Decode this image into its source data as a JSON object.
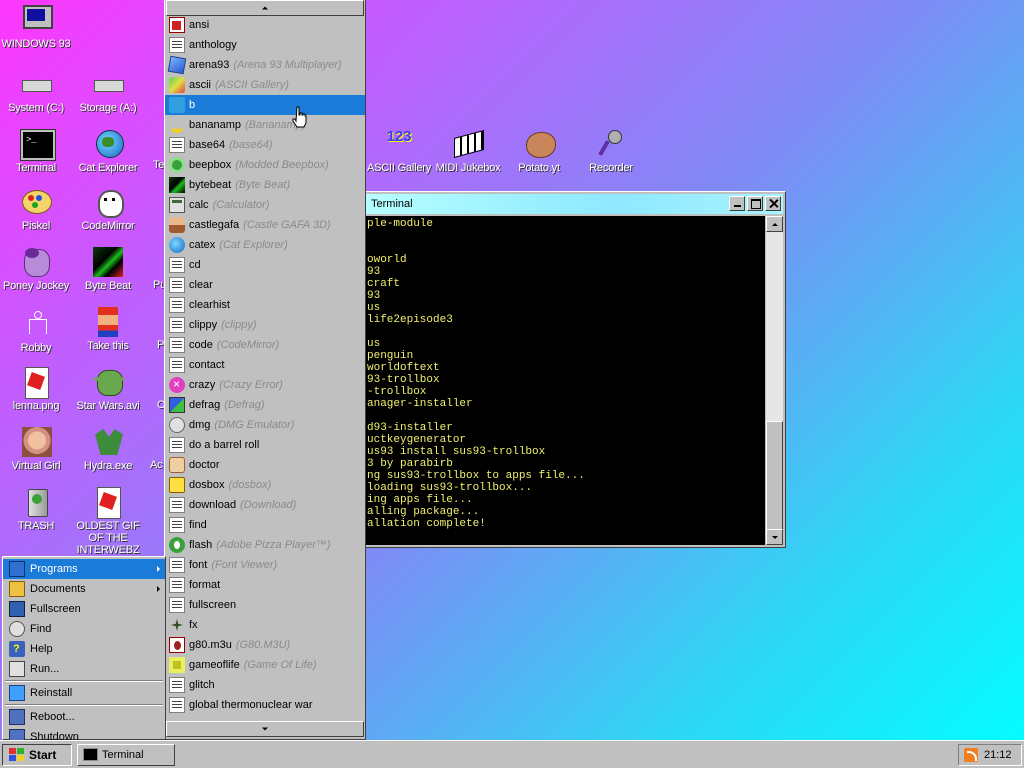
{
  "desktop": {
    "icons": [
      {
        "label": "WINDOWS 93",
        "icon": "monitor-icon"
      },
      {
        "label": "System (C:)",
        "icon": "drive-icon"
      },
      {
        "label": "Storage (A:)",
        "icon": "floppy-drive-icon"
      },
      {
        "label": "Terminal",
        "icon": "terminal-icon"
      },
      {
        "label": "Cat Explorer",
        "icon": "cat-globe-icon"
      },
      {
        "label": "Piskel",
        "icon": "palette-icon"
      },
      {
        "label": "CodeMirror",
        "icon": "cat-icon"
      },
      {
        "label": "Poney Jockey",
        "icon": "pony-icon"
      },
      {
        "label": "Byte Beat",
        "icon": "bytebeat-icon"
      },
      {
        "label": "Robby",
        "icon": "robot-icon"
      },
      {
        "label": "Take this",
        "icon": "mario-icon"
      },
      {
        "label": "lenna.png",
        "icon": "image-icon"
      },
      {
        "label": "Star Wars.avi",
        "icon": "yoda-icon"
      },
      {
        "label": "Virtual Girl",
        "icon": "face-icon"
      },
      {
        "label": "Hydra.exe",
        "icon": "hydra-icon"
      },
      {
        "label": "TRASH",
        "icon": "trash-icon"
      },
      {
        "label": "OLDEST GIF OF THE INTERWEBZ",
        "icon": "gif-icon"
      },
      {
        "label": "ASCII Gallery",
        "icon": "numbers-icon"
      },
      {
        "label": "MIDI Jukebox",
        "icon": "piano-icon"
      },
      {
        "label": "Potato.yt",
        "icon": "potato-icon"
      },
      {
        "label": "Recorder",
        "icon": "microphone-icon"
      }
    ],
    "partial_labels": [
      "Te",
      "Pu",
      "P",
      "O",
      "Ac"
    ]
  },
  "programs_menu": {
    "selected_index": 4,
    "items": [
      {
        "name": "ansi",
        "desc": "",
        "icon": "ansi"
      },
      {
        "name": "anthology",
        "desc": "",
        "icon": "generic"
      },
      {
        "name": "arena93",
        "desc": "(Arena 93 Multiplayer)",
        "icon": "cube"
      },
      {
        "name": "ascii",
        "desc": "(ASCII Gallery)",
        "icon": "art"
      },
      {
        "name": "b",
        "desc": "",
        "icon": "b"
      },
      {
        "name": "bananamp",
        "desc": "(Bananamp)",
        "icon": "banana"
      },
      {
        "name": "base64",
        "desc": "(base64)",
        "icon": "generic"
      },
      {
        "name": "beepbox",
        "desc": "(Modded Beepbox)",
        "icon": "circle"
      },
      {
        "name": "bytebeat",
        "desc": "(Byte Beat)",
        "icon": "bytebeat"
      },
      {
        "name": "calc",
        "desc": "(Calculator)",
        "icon": "calc"
      },
      {
        "name": "castlegafa",
        "desc": "(Castle GAFA 3D)",
        "icon": "castle"
      },
      {
        "name": "catex",
        "desc": "(Cat Explorer)",
        "icon": "catglobe"
      },
      {
        "name": "cd",
        "desc": "",
        "icon": "generic"
      },
      {
        "name": "clear",
        "desc": "",
        "icon": "generic"
      },
      {
        "name": "clearhist",
        "desc": "",
        "icon": "generic"
      },
      {
        "name": "clippy",
        "desc": "(clippy)",
        "icon": "generic"
      },
      {
        "name": "code",
        "desc": "(CodeMirror)",
        "icon": "generic"
      },
      {
        "name": "contact",
        "desc": "",
        "icon": "generic"
      },
      {
        "name": "crazy",
        "desc": "(Crazy Error)",
        "icon": "crazy"
      },
      {
        "name": "defrag",
        "desc": "(Defrag)",
        "icon": "defrag"
      },
      {
        "name": "dmg",
        "desc": "(DMG Emulator)",
        "icon": "dmg"
      },
      {
        "name": "do a barrel roll",
        "desc": "",
        "icon": "generic"
      },
      {
        "name": "doctor",
        "desc": "",
        "icon": "doctor"
      },
      {
        "name": "dosbox",
        "desc": "(dosbox)",
        "icon": "dosbox"
      },
      {
        "name": "download",
        "desc": "(Download)",
        "icon": "generic"
      },
      {
        "name": "find",
        "desc": "",
        "icon": "generic"
      },
      {
        "name": "flash",
        "desc": "(Adobe Pizza Player™)",
        "icon": "flash"
      },
      {
        "name": "font",
        "desc": "(Font Viewer)",
        "icon": "generic"
      },
      {
        "name": "format",
        "desc": "",
        "icon": "generic"
      },
      {
        "name": "fullscreen",
        "desc": "",
        "icon": "generic"
      },
      {
        "name": "fx",
        "desc": "",
        "icon": "fx"
      },
      {
        "name": "g80.m3u",
        "desc": "(G80.M3U)",
        "icon": "g80"
      },
      {
        "name": "gameoflife",
        "desc": "(Game Of Life)",
        "icon": "life"
      },
      {
        "name": "glitch",
        "desc": "",
        "icon": "generic"
      },
      {
        "name": "global thermonuclear war",
        "desc": "",
        "icon": "generic"
      }
    ]
  },
  "start_menu": {
    "items": [
      {
        "label": "Programs",
        "submenu": true,
        "icon": "programs"
      },
      {
        "label": "Documents",
        "submenu": true,
        "icon": "folder"
      },
      {
        "label": "Fullscreen",
        "submenu": false,
        "icon": "full"
      },
      {
        "label": "Find",
        "submenu": false,
        "icon": "find"
      },
      {
        "label": "Help",
        "submenu": false,
        "icon": "help"
      },
      {
        "label": "Run...",
        "submenu": false,
        "icon": "run"
      },
      {
        "label": "Reinstall",
        "submenu": false,
        "icon": "reinstall"
      },
      {
        "label": "Reboot...",
        "submenu": false,
        "icon": "reboot"
      },
      {
        "label": "Shutdown",
        "submenu": false,
        "icon": "shutdown"
      }
    ]
  },
  "terminal": {
    "title": "Terminal",
    "lines": [
      "ple-module",
      "",
      "",
      "oworld",
      "93",
      "craft",
      "93",
      "us",
      "life2episode3",
      "",
      "us",
      "penguin",
      "worldoftext",
      "93-trollbox",
      "-trollbox",
      "anager-installer",
      "",
      "d93-installer",
      "uctkeygenerator",
      "us93 install sus93-trollbox",
      "3 by parabirb",
      "ng sus93-trollbox to apps file...",
      "loading sus93-trollbox...",
      "ing apps file...",
      "alling package...",
      "allation complete!"
    ]
  },
  "taskbar": {
    "start_label": "Start",
    "task_label": "Terminal",
    "clock": "21:12"
  }
}
